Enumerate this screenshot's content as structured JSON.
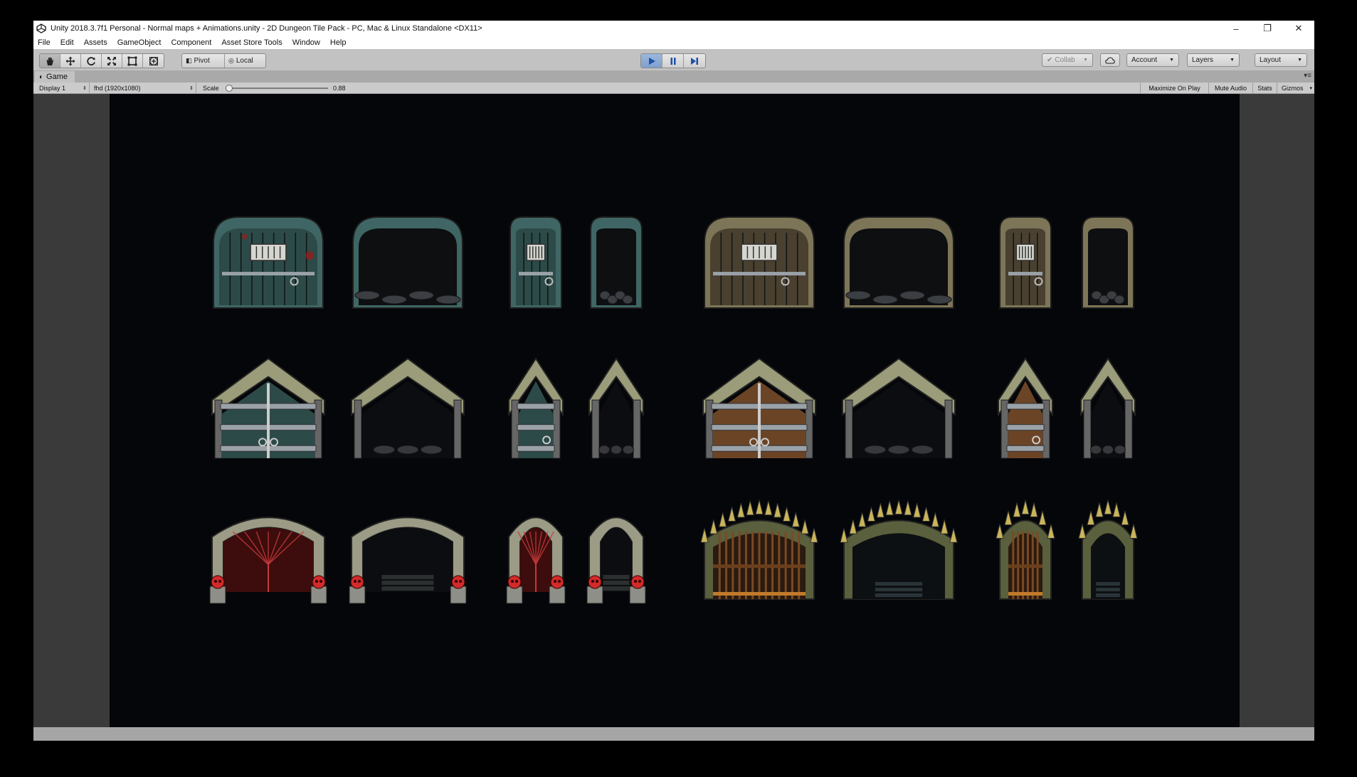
{
  "window": {
    "title": "Unity 2018.3.7f1 Personal - Normal maps + Animations.unity - 2D Dungeon Tile Pack - PC, Mac & Linux Standalone <DX11>",
    "controls": {
      "minimize": "–",
      "restore": "❐",
      "close": "✕"
    }
  },
  "menu": {
    "file": "File",
    "edit": "Edit",
    "assets": "Assets",
    "gameobject": "GameObject",
    "component": "Component",
    "asset_store_tools": "Asset Store Tools",
    "window": "Window",
    "help": "Help"
  },
  "toolbar": {
    "transform_tools": [
      "hand-icon",
      "move-icon",
      "rotate-icon",
      "scale-icon",
      "rect-tool-icon",
      "transform-tool-icon"
    ],
    "pivot_label": "Pivot",
    "local_label": "Local",
    "collab_label": "Collab",
    "account_label": "Account",
    "layers_label": "Layers",
    "layout_label": "Layout",
    "play_state": "playing"
  },
  "game_panel": {
    "tab_label": "Game",
    "display_label": "Display 1",
    "resolution_label": "fhd (1920x1080)",
    "scale_label": "Scale",
    "scale_value": "0.88",
    "scale_fraction": 0.0,
    "maximize_on_play": "Maximize On Play",
    "mute_audio": "Mute Audio",
    "stats": "Stats",
    "gizmos": "Gizmos"
  },
  "colors": {
    "editor_bg": "#c2c2c2",
    "game_bg": "#050609",
    "play_active": "#7fa0cc",
    "teal_wood": "#2c4a48",
    "brown_wood": "#4a4030",
    "stone_frame": "#8a8f72",
    "metal_band": "#9aa2a8",
    "red_glow": "#a31818",
    "spike_yellow": "#c9b45a"
  },
  "scene": {
    "rows": [
      {
        "style": "wooden-arch-doors",
        "items": [
          {
            "name": "teal-wide-door-closed",
            "color": "teal"
          },
          {
            "name": "teal-wide-door-open",
            "color": "teal"
          },
          {
            "name": "teal-narrow-door-closed",
            "color": "teal"
          },
          {
            "name": "teal-narrow-door-open",
            "color": "teal"
          },
          {
            "name": "brown-wide-door-closed",
            "color": "brown"
          },
          {
            "name": "brown-wide-door-open",
            "color": "brown"
          },
          {
            "name": "brown-narrow-door-closed",
            "color": "brown"
          },
          {
            "name": "brown-narrow-door-open",
            "color": "brown"
          }
        ]
      },
      {
        "style": "peaked-banded-doors",
        "items": [
          {
            "name": "teal-peaked-double-door-closed",
            "color": "teal"
          },
          {
            "name": "teal-peaked-double-door-open",
            "color": "teal"
          },
          {
            "name": "teal-peaked-single-door-closed",
            "color": "teal"
          },
          {
            "name": "teal-peaked-single-door-open",
            "color": "teal"
          },
          {
            "name": "brown-peaked-double-door-closed",
            "color": "brown"
          },
          {
            "name": "brown-peaked-double-door-open",
            "color": "brown"
          },
          {
            "name": "brown-peaked-single-door-closed",
            "color": "brown"
          },
          {
            "name": "brown-peaked-single-door-open",
            "color": "brown"
          }
        ]
      },
      {
        "style": "skull-and-spike-gates",
        "items": [
          {
            "name": "skull-portal-wide-closed",
            "color": "red"
          },
          {
            "name": "skull-portal-wide-open",
            "color": "red"
          },
          {
            "name": "skull-portal-narrow-closed",
            "color": "red"
          },
          {
            "name": "skull-portal-narrow-open",
            "color": "red"
          },
          {
            "name": "spiked-gate-wide-closed",
            "color": "yellow"
          },
          {
            "name": "spiked-gate-wide-open",
            "color": "yellow"
          },
          {
            "name": "spiked-gate-narrow-closed",
            "color": "yellow"
          },
          {
            "name": "spiked-gate-narrow-open",
            "color": "yellow"
          }
        ]
      }
    ]
  }
}
